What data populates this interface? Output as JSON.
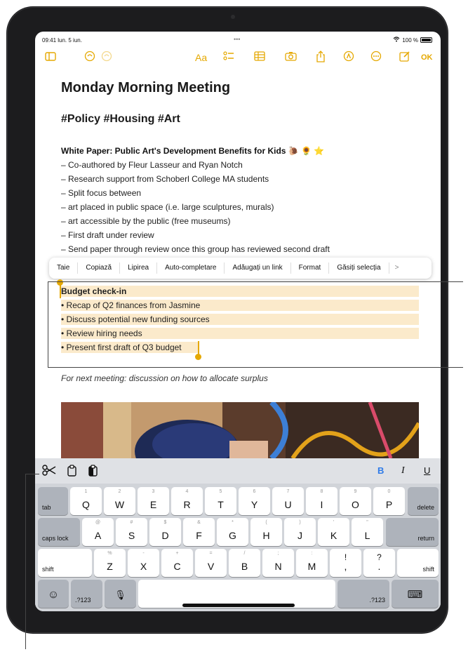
{
  "status": {
    "time": "09:41  lun. 5 iun.",
    "dots": "•••",
    "battery": "100 %"
  },
  "toolbar": {
    "aa": "Aa",
    "ok": "OK"
  },
  "note": {
    "title": "Monday Morning Meeting",
    "tags": "#Policy #Housing #Art",
    "whitepaper_heading": "White Paper: Public Art's Development Benefits for Kids 🐌 🌻 ⭐",
    "lines": [
      "– Co-authored by Fleur Lasseur and Ryan Notch",
      "– Research support from Schoberl College MA students",
      "– Split focus between",
      "– art placed in public space (i.e. large sculptures, murals)",
      "– art accessible by the public (free museums)",
      "– First draft under review",
      "– Send paper through review once this group has reviewed second draft"
    ],
    "budget_heading": "Budget check-in",
    "budget_lines": [
      "• Recap of Q2 finances from Jasmine",
      "• Discuss potential new funding sources",
      "• Review hiring needs",
      "• Present first draft of Q3 budget"
    ],
    "next_meeting": "For next meeting: discussion on how to allocate surplus"
  },
  "edit_menu": [
    "Taie",
    "Copiază",
    "Lipirea",
    "Auto-completare",
    "Adăugați un link",
    "Format",
    "Găsiți selecția",
    ">"
  ],
  "format": {
    "bold": "B",
    "italic": "I",
    "underline": "U"
  },
  "keyboard": {
    "row1": {
      "left": "tab",
      "keys": [
        [
          "Q",
          "1"
        ],
        [
          "W",
          "2"
        ],
        [
          "E",
          "3"
        ],
        [
          "R",
          "4"
        ],
        [
          "T",
          "5"
        ],
        [
          "Y",
          "6"
        ],
        [
          "U",
          "7"
        ],
        [
          "I",
          "8"
        ],
        [
          "O",
          "9"
        ],
        [
          "P",
          "0"
        ]
      ],
      "right": "delete"
    },
    "row2": {
      "left": "caps lock",
      "keys": [
        [
          "A",
          "@"
        ],
        [
          "S",
          "#"
        ],
        [
          "D",
          "$"
        ],
        [
          "F",
          "&"
        ],
        [
          "G",
          "*"
        ],
        [
          "H",
          "("
        ],
        [
          "J",
          ")"
        ],
        [
          "K",
          "'"
        ],
        [
          "L",
          "\""
        ]
      ],
      "right": "return"
    },
    "row3": {
      "left": "shift",
      "keys": [
        [
          "Z",
          "%"
        ],
        [
          "X",
          "-"
        ],
        [
          "C",
          "+"
        ],
        [
          "V",
          "="
        ],
        [
          "B",
          "/"
        ],
        [
          "N",
          ";"
        ],
        [
          "M",
          ":"
        ],
        [
          "!",
          ","
        ],
        [
          "?",
          "."
        ]
      ],
      "right": "shift"
    },
    "row4": {
      "emoji": "☺",
      "num_left": ".?123",
      "mic": "🎙",
      "num_right": ".?123",
      "hide": "⌨"
    }
  },
  "colors": {
    "accent": "#e5a800",
    "highlight": "#fbeacb",
    "keyboard_bg": "#d1d4d9"
  }
}
